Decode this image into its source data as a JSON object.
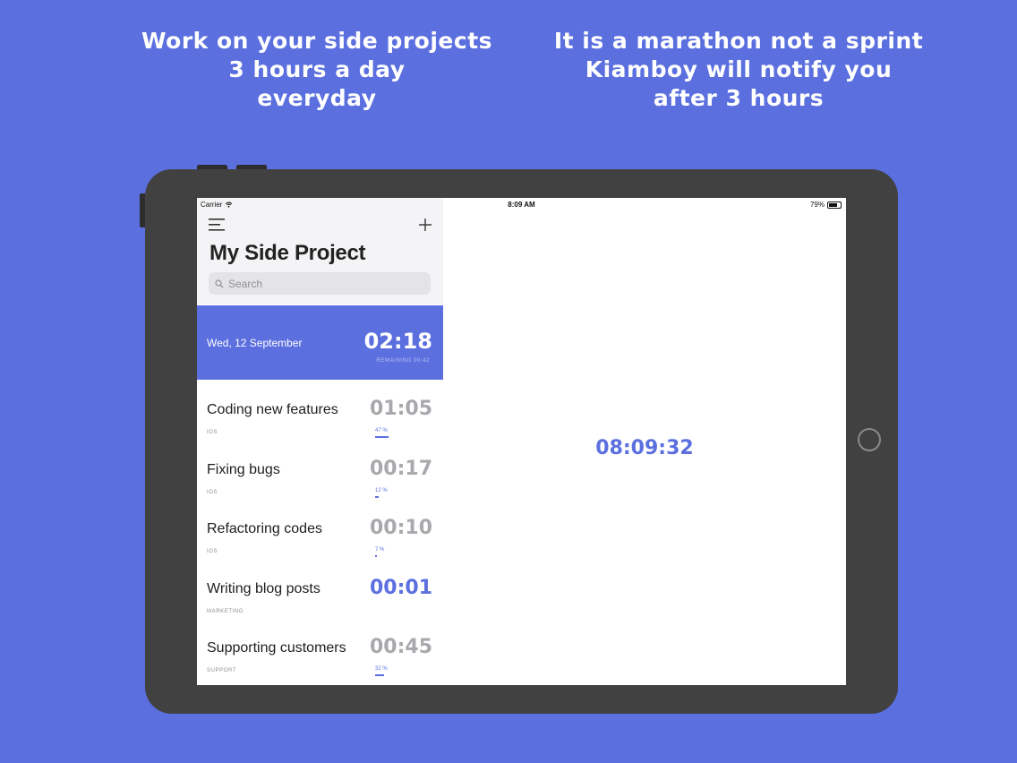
{
  "headlines": {
    "left": [
      "Work on your side projects",
      "3 hours a day",
      "everyday"
    ],
    "right": [
      "It is a marathon not a sprint",
      "Kiamboy will notify you",
      "after 3 hours"
    ]
  },
  "status_bar": {
    "carrier": "Carrier",
    "time": "8:09 AM",
    "battery": "79%",
    "battery_level": 0.79
  },
  "sidebar": {
    "title": "My Side Project",
    "search": {
      "placeholder": "Search"
    },
    "today": {
      "date": "Wed, 12 September",
      "timer": "02:18",
      "remaining": "REMAINING 00:42"
    },
    "projects": [
      {
        "name": "Coding new features",
        "category": "IOS",
        "time": "01:05",
        "progress_label": "47 %",
        "progress": 47,
        "active": false
      },
      {
        "name": "Fixing bugs",
        "category": "IOS",
        "time": "00:17",
        "progress_label": "12 %",
        "progress": 12,
        "active": false
      },
      {
        "name": "Refactoring codes",
        "category": "IOS",
        "time": "00:10",
        "progress_label": "7 %",
        "progress": 7,
        "active": false
      },
      {
        "name": "Writing blog posts",
        "category": "MARKETING",
        "time": "00:01",
        "progress_label": "",
        "progress": 0,
        "active": true
      },
      {
        "name": "Supporting customers",
        "category": "SUPPORT",
        "time": "00:45",
        "progress_label": "32 %",
        "progress": 32,
        "active": false
      }
    ]
  },
  "detail": {
    "clock": "08:09:32"
  },
  "colors": {
    "accent": "#5b6fdf",
    "background": "#5b6fdf",
    "device": "#414141",
    "inactive_timer": "#a9a9ad"
  },
  "icons": [
    "menu-icon",
    "plus-icon",
    "search-icon",
    "wifi-icon",
    "battery-icon"
  ]
}
